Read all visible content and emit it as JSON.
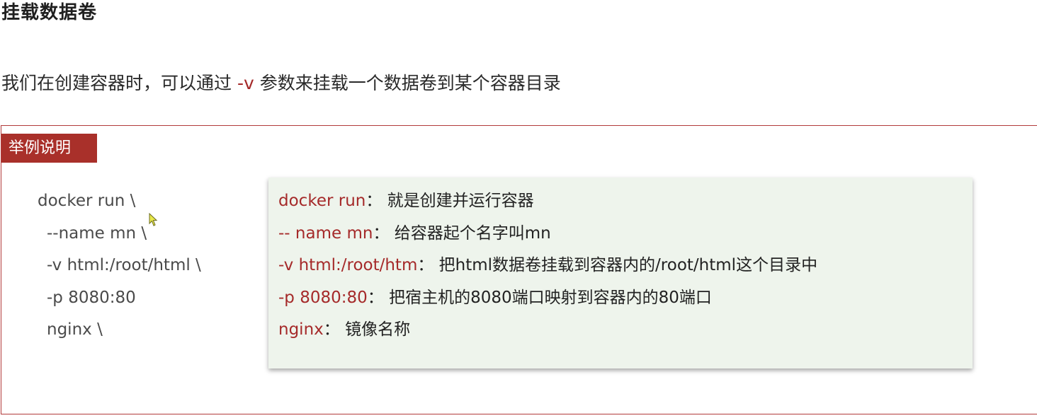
{
  "title": "挂载数据卷",
  "intro": {
    "before": "我们在创建容器时，可以通过 ",
    "flag": "-v",
    "after": " 参数来挂载一个数据卷到某个容器目录"
  },
  "example": {
    "label": "举例说明",
    "command_lines": [
      "docker run \\",
      "--name mn \\",
      "-v html:/root/html \\",
      "-p 8080:80",
      "nginx \\"
    ],
    "explanations": [
      {
        "key": "docker run",
        "sep": "： ",
        "desc": "就是创建并运行容器"
      },
      {
        "key": "-- name mn",
        "sep": "： ",
        "desc": "给容器起个名字叫mn"
      },
      {
        "key": "-v html:/root/htm",
        "sep": "： ",
        "desc": "把html数据卷挂载到容器内的/root/html这个目录中"
      },
      {
        "key": "-p 8080:80",
        "sep": "： ",
        "desc": "把宿主机的8080端口映射到容器内的80端口"
      },
      {
        "key": "nginx",
        "sep": "： ",
        "desc": "镜像名称"
      }
    ]
  },
  "colors": {
    "accent": "#a9302a",
    "keyword": "#a52a2a",
    "panel_bg": "#eef4ec"
  }
}
